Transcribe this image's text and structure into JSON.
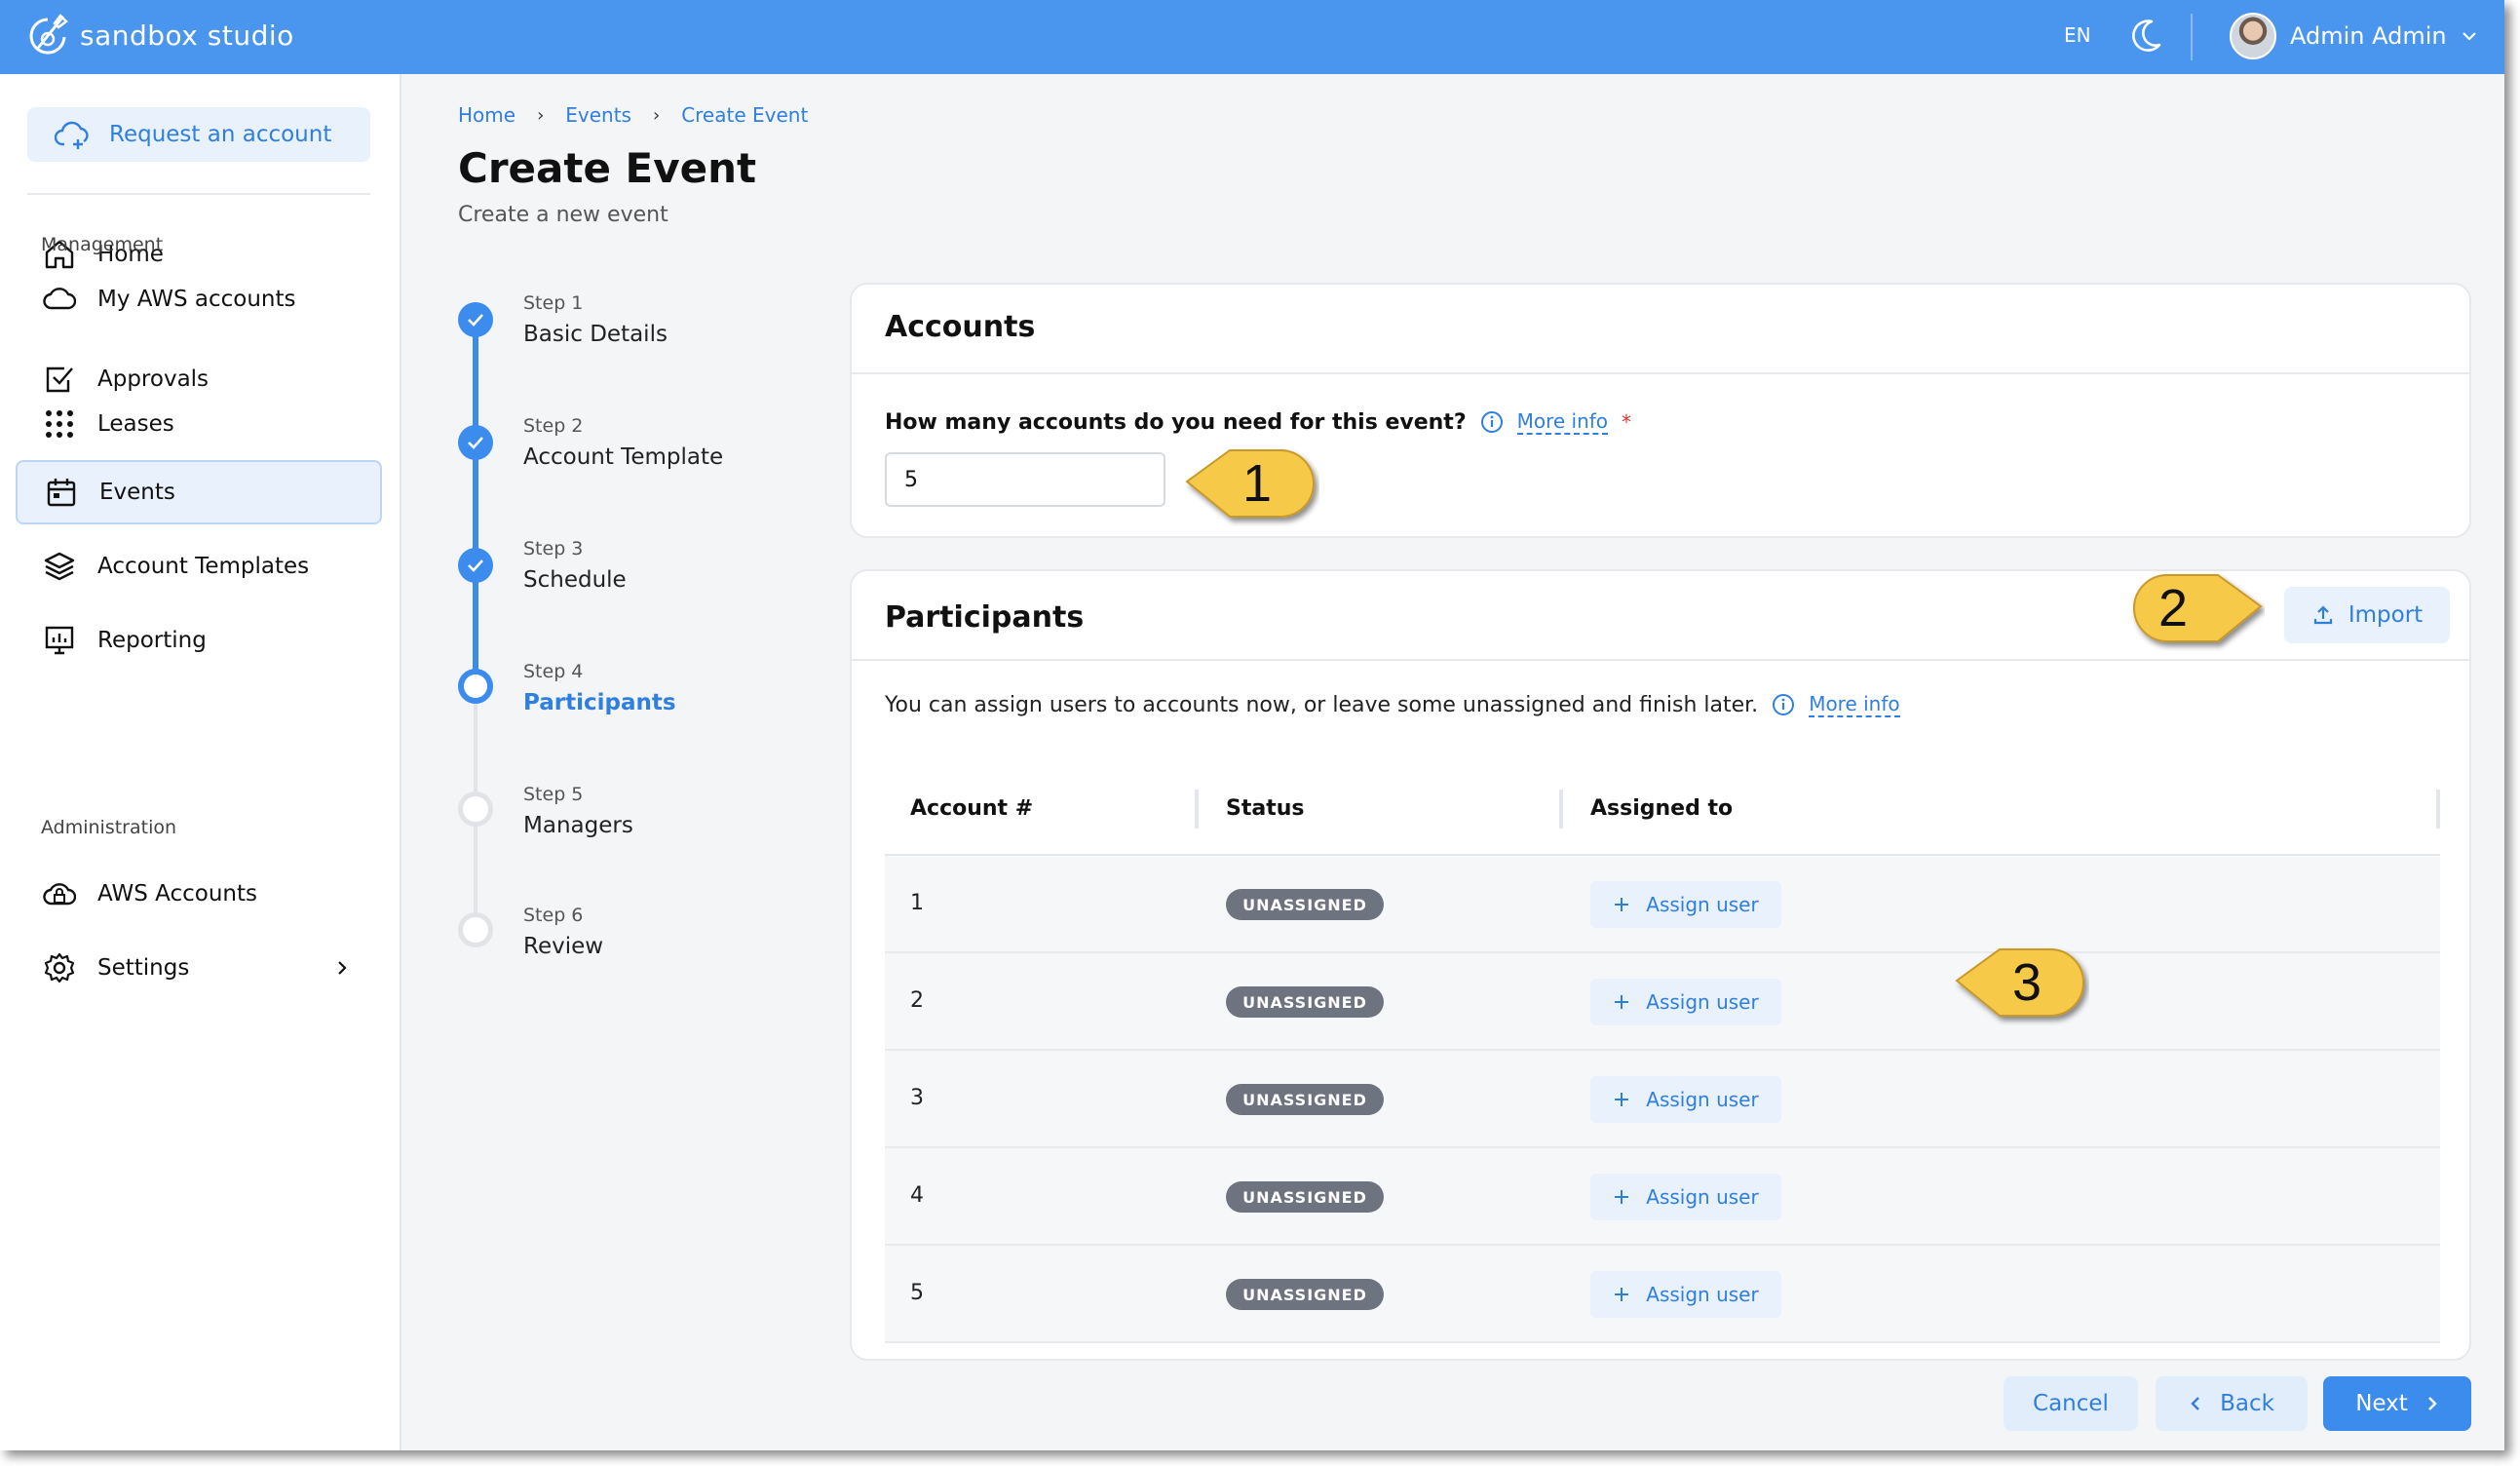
{
  "app": {
    "name": "sandbox studio"
  },
  "topbar": {
    "language": "EN",
    "user_name": "Admin Admin"
  },
  "sidebar": {
    "request_button": "Request an account",
    "items_top": [
      {
        "label": "Home",
        "icon": "home-icon"
      },
      {
        "label": "My AWS accounts",
        "icon": "cloud-icon"
      }
    ],
    "section_management": "Management",
    "items_management": [
      {
        "label": "Approvals",
        "icon": "checkbox-icon"
      },
      {
        "label": "Leases",
        "icon": "grid-dots-icon"
      },
      {
        "label": "Events",
        "icon": "calendar-icon",
        "active": true
      },
      {
        "label": "Account Templates",
        "icon": "layers-icon"
      },
      {
        "label": "Reporting",
        "icon": "presentation-chart-icon"
      }
    ],
    "section_administration": "Administration",
    "items_administration": [
      {
        "label": "AWS Accounts",
        "icon": "cloud-lock-icon"
      },
      {
        "label": "Settings",
        "icon": "gear-icon"
      }
    ]
  },
  "breadcrumb": [
    "Home",
    "Events",
    "Create Event"
  ],
  "page": {
    "title": "Create Event",
    "subtitle": "Create a new event"
  },
  "steps": [
    {
      "num": "Step 1",
      "name": "Basic Details",
      "state": "done"
    },
    {
      "num": "Step 2",
      "name": "Account Template",
      "state": "done"
    },
    {
      "num": "Step 3",
      "name": "Schedule",
      "state": "done"
    },
    {
      "num": "Step 4",
      "name": "Participants",
      "state": "current"
    },
    {
      "num": "Step 5",
      "name": "Managers",
      "state": "todo"
    },
    {
      "num": "Step 6",
      "name": "Review",
      "state": "todo"
    }
  ],
  "accounts_card": {
    "title": "Accounts",
    "question": "How many accounts do you need for this event?",
    "more_info": "More info",
    "required": "*",
    "count_value": "5"
  },
  "participants_card": {
    "title": "Participants",
    "import_label": "Import",
    "description": "You can assign users to accounts now, or leave some unassigned and finish later.",
    "more_info": "More info",
    "columns": [
      "Account #",
      "Status",
      "Assigned to"
    ],
    "rows": [
      {
        "account": "1",
        "status": "UNASSIGNED",
        "action": "Assign user"
      },
      {
        "account": "2",
        "status": "UNASSIGNED",
        "action": "Assign user"
      },
      {
        "account": "3",
        "status": "UNASSIGNED",
        "action": "Assign user"
      },
      {
        "account": "4",
        "status": "UNASSIGNED",
        "action": "Assign user"
      },
      {
        "account": "5",
        "status": "UNASSIGNED",
        "action": "Assign user"
      }
    ]
  },
  "footer": {
    "cancel": "Cancel",
    "back": "Back",
    "next": "Next"
  },
  "callouts": [
    "1",
    "2",
    "3"
  ],
  "colors": {
    "primary": "#3b8ced",
    "topbar": "#4a95ee",
    "callout": "#f7c94a",
    "badge": "#6d7480"
  }
}
